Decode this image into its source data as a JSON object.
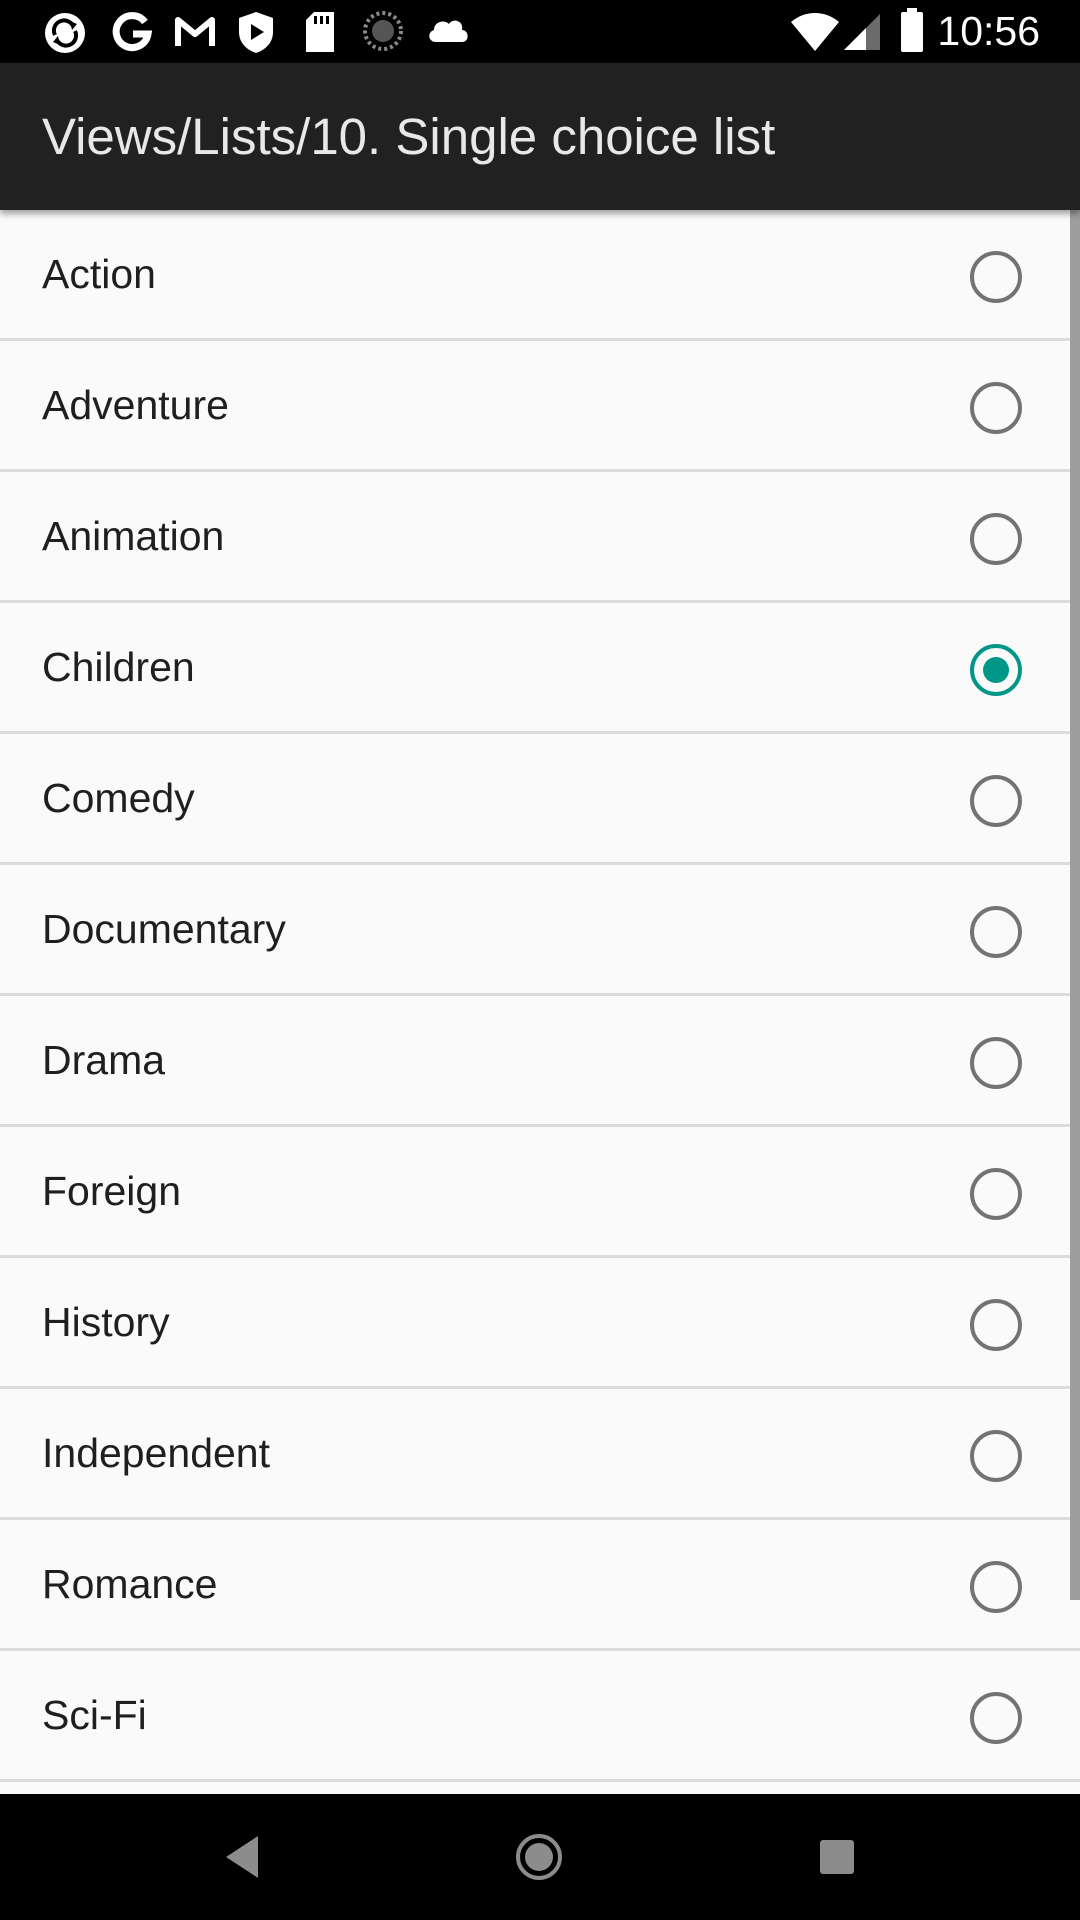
{
  "status_bar": {
    "time": "10:56",
    "left_icons": [
      "sync-icon",
      "google-icon",
      "gmail-icon",
      "play-protect-icon",
      "sd-card-icon",
      "loading-icon",
      "cloud-icon"
    ],
    "right_icons": [
      "wifi-icon",
      "cellular-signal-icon",
      "battery-icon"
    ]
  },
  "app_bar": {
    "title": "Views/Lists/10. Single choice list"
  },
  "list": {
    "items": [
      {
        "label": "Action",
        "checked": false
      },
      {
        "label": "Adventure",
        "checked": false
      },
      {
        "label": "Animation",
        "checked": false
      },
      {
        "label": "Children",
        "checked": true
      },
      {
        "label": "Comedy",
        "checked": false
      },
      {
        "label": "Documentary",
        "checked": false
      },
      {
        "label": "Drama",
        "checked": false
      },
      {
        "label": "Foreign",
        "checked": false
      },
      {
        "label": "History",
        "checked": false
      },
      {
        "label": "Independent",
        "checked": false
      },
      {
        "label": "Romance",
        "checked": false
      },
      {
        "label": "Sci-Fi",
        "checked": false
      }
    ]
  },
  "nav_bar": {
    "icons": [
      "back-icon",
      "home-icon",
      "recents-icon"
    ]
  },
  "colors": {
    "accent": "#009688",
    "app_bar": "#212121",
    "background": "#fafafa",
    "divider": "#dcdcdc",
    "radio_unchecked": "#737373"
  }
}
